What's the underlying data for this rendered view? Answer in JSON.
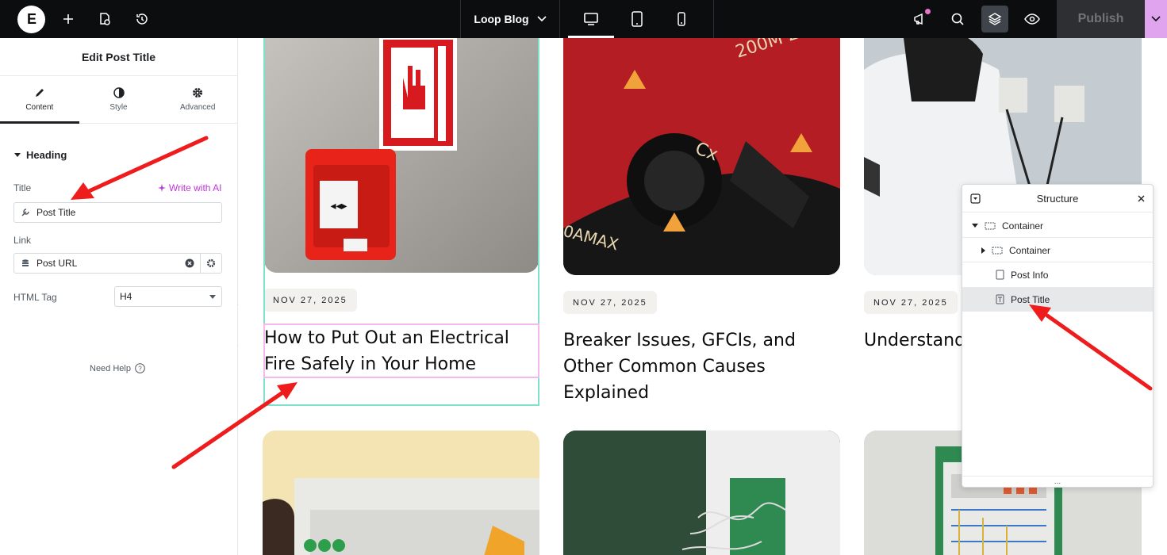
{
  "topbar": {
    "document_title": "Loop Blog",
    "publish_label": "Publish",
    "icons": [
      "elementor-logo-icon",
      "add-element-icon",
      "page-settings-icon",
      "history-icon",
      "chevron-down-icon",
      "desktop-icon",
      "tablet-icon",
      "mobile-icon",
      "announcements-icon",
      "search-icon",
      "structure-layers-icon",
      "preview-eye-icon"
    ]
  },
  "panel": {
    "header_title": "Edit Post Title",
    "tabs": [
      {
        "label": "Content",
        "icon": "pencil-icon"
      },
      {
        "label": "Style",
        "icon": "half-circle-icon"
      },
      {
        "label": "Advanced",
        "icon": "gear-icon"
      }
    ],
    "section_title": "Heading",
    "title_label": "Title",
    "write_ai_label": "Write with AI",
    "title_value": "Post Title",
    "link_label": "Link",
    "link_value": "Post URL",
    "html_tag_label": "HTML Tag",
    "html_tag_value": "H4",
    "need_help": "Need Help"
  },
  "posts": [
    {
      "date": "NOV 27, 2025",
      "title_line1": "How to Put Out an Electrical",
      "title_line2": "Fire Safely in Your Home",
      "title_line3": ""
    },
    {
      "date": "NOV 27, 2025",
      "title_line1": "Breaker Issues, GFCIs, and",
      "title_line2": "Other Common Causes",
      "title_line3": "Explained"
    },
    {
      "date": "NOV 27, 2025",
      "title_line1": "Understand",
      "title_line2": "",
      "title_line3": ""
    }
  ],
  "structure": {
    "title": "Structure",
    "items": [
      {
        "label": "Container"
      },
      {
        "label": "Container"
      },
      {
        "label": "Post Info"
      },
      {
        "label": "Post Title"
      }
    ],
    "footer": "..."
  },
  "colors": {
    "topbar_bg": "#0c0d0e",
    "accent_pink": "#c036d8",
    "selection_teal": "#7ee1cc",
    "selection_pink": "#f4b8ef",
    "annotation_red": "#ee1c1c"
  }
}
